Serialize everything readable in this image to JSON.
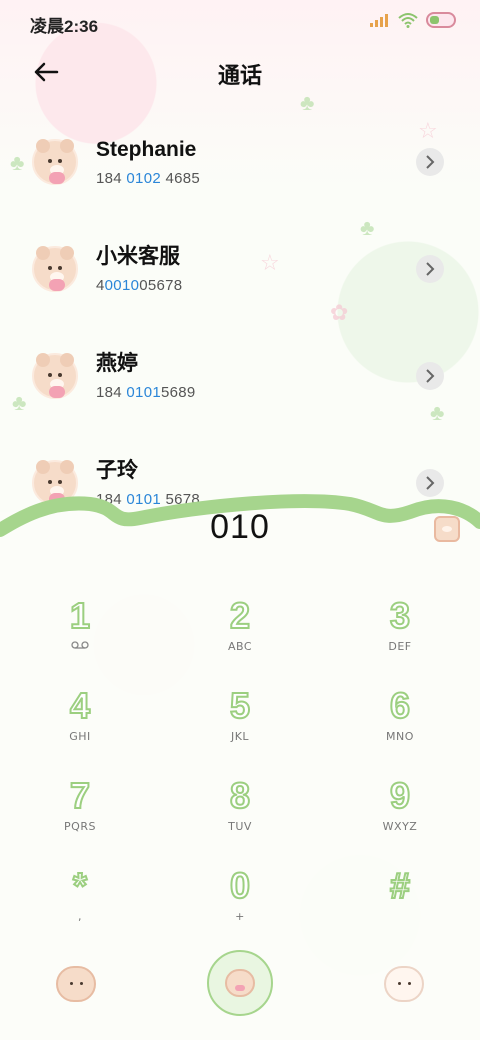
{
  "status_bar": {
    "time": "凌晨2:36"
  },
  "header": {
    "title": "通话"
  },
  "contacts": [
    {
      "name": "Stephanie",
      "number_pre": "184 ",
      "number_hl": "0102",
      "number_post": " 4685"
    },
    {
      "name": "小米客服",
      "number_pre": "4",
      "number_hl": "0010",
      "number_post": "05678"
    },
    {
      "name": "燕婷",
      "number_pre": "184 ",
      "number_hl": "0101",
      "number_post": "5689"
    },
    {
      "name": "子玲",
      "number_pre": "184 ",
      "number_hl": "0101",
      "number_post": " 5678"
    }
  ],
  "dialer": {
    "input": "010",
    "keys": [
      {
        "digit": "1",
        "letters": ""
      },
      {
        "digit": "2",
        "letters": "ABC"
      },
      {
        "digit": "3",
        "letters": "DEF"
      },
      {
        "digit": "4",
        "letters": "GHI"
      },
      {
        "digit": "5",
        "letters": "JKL"
      },
      {
        "digit": "6",
        "letters": "MNO"
      },
      {
        "digit": "7",
        "letters": "PQRS"
      },
      {
        "digit": "8",
        "letters": "TUV"
      },
      {
        "digit": "9",
        "letters": "WXYZ"
      },
      {
        "digit": "*",
        "letters": ","
      },
      {
        "digit": "0",
        "letters": "+"
      },
      {
        "digit": "#",
        "letters": ""
      }
    ]
  },
  "colors": {
    "accent_green": "#9ccf80",
    "highlight_blue": "#2b86d8",
    "background": "#fbfdf8"
  },
  "icons": {
    "back": "arrow-left-icon",
    "chevron": "chevron-right-icon",
    "voicemail": "voicemail-icon"
  }
}
